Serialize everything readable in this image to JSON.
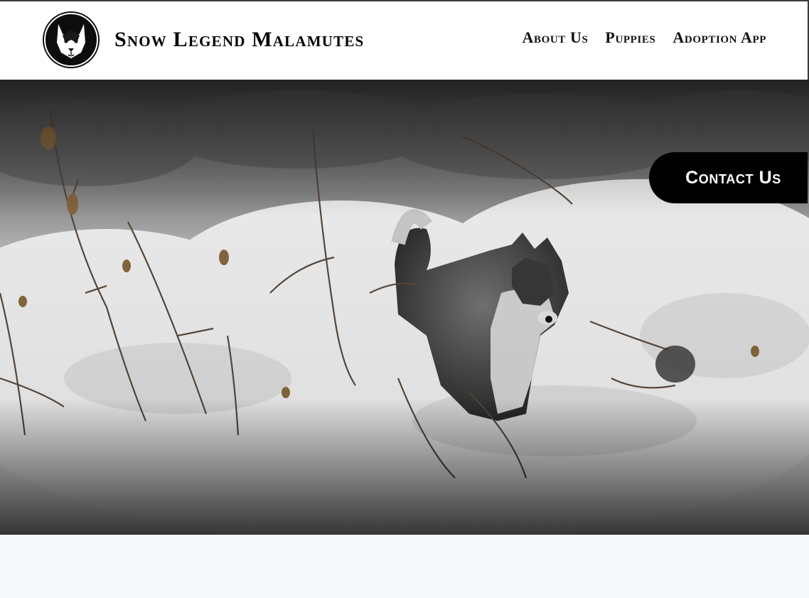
{
  "header": {
    "site_title": "Snow Legend Malamutes",
    "logo_icon": "malamute-head-logo"
  },
  "nav": {
    "items": [
      "About Us",
      "Puppies",
      "Adoption App"
    ]
  },
  "hero": {
    "image": "malamute-in-snowy-forest",
    "contact_label": "Contact Us"
  },
  "colors": {
    "header_bg": "#ffffff",
    "text": "#111111",
    "contact_bg": "#000000",
    "contact_text": "#ffffff",
    "page_bg": "#f7f8fa"
  }
}
